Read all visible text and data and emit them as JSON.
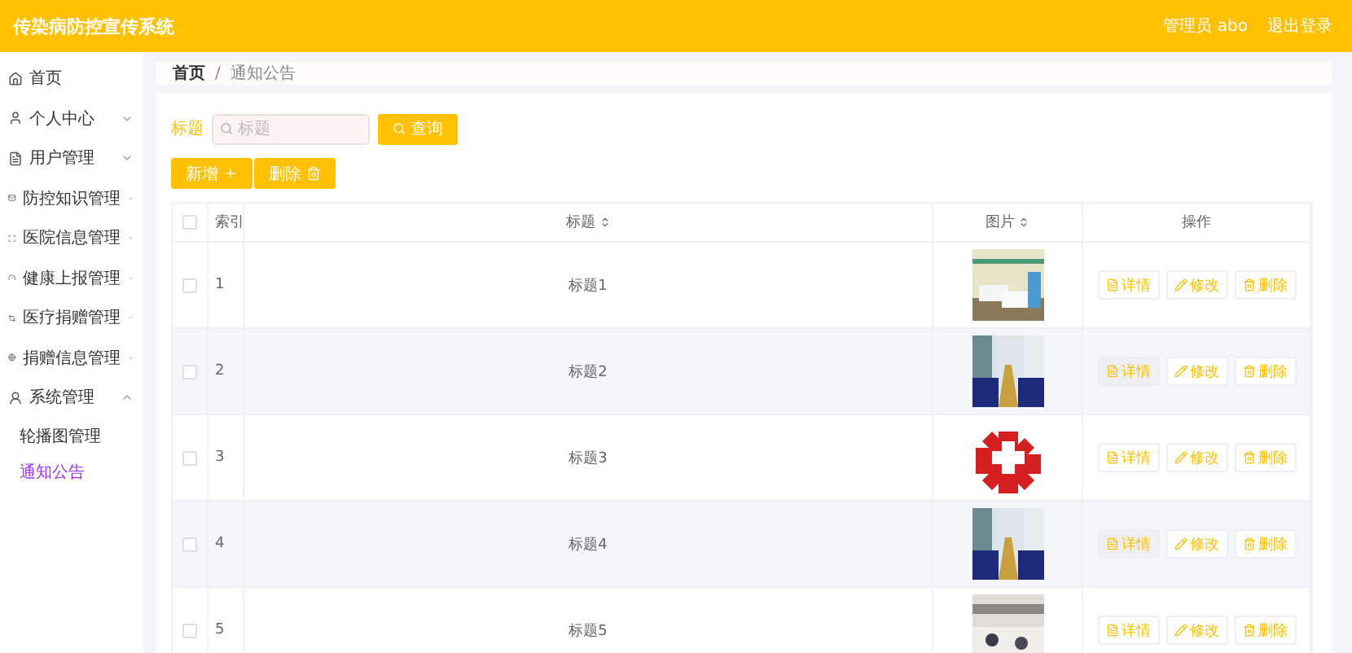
{
  "header": {
    "title": "传染病防控宣传系统",
    "user": "管理员 abo",
    "logout": "退出登录"
  },
  "sidebar": {
    "items": [
      {
        "label": "首页"
      },
      {
        "label": "个人中心",
        "expanded": false
      },
      {
        "label": "用户管理",
        "expanded": false
      },
      {
        "label": "防控知识管理",
        "expanded": false
      },
      {
        "label": "医院信息管理",
        "expanded": false
      },
      {
        "label": "健康上报管理",
        "expanded": false
      },
      {
        "label": "医疗捐赠管理",
        "expanded": false
      },
      {
        "label": "捐赠信息管理",
        "expanded": false
      },
      {
        "label": "系统管理",
        "expanded": true,
        "children": [
          {
            "label": "轮播图管理",
            "selected": false
          },
          {
            "label": "通知公告",
            "selected": true
          }
        ]
      }
    ]
  },
  "breadcrumb": {
    "items": [
      "首页",
      "通知公告"
    ],
    "separator": "/"
  },
  "search": {
    "label": "标题",
    "placeholder": "标题",
    "button": "查询"
  },
  "actions": [
    {
      "label": "新增",
      "kind": "add"
    },
    {
      "label": "删除",
      "kind": "delete"
    }
  ],
  "table": {
    "all_checked": false,
    "columns": [
      {
        "label": "索引",
        "sortable": false
      },
      {
        "label": "标题",
        "sortable": true
      },
      {
        "label": "图片",
        "sortable": true
      },
      {
        "label": "操作",
        "sortable": false
      }
    ],
    "rows": [
      {
        "index": "1",
        "title": "标题1",
        "checked": false,
        "picture": {
          "kind": "picture"
        },
        "actions": [
          {
            "label": "详情",
            "kind": "detail"
          },
          {
            "label": "修改",
            "kind": "edit"
          },
          {
            "label": "删除",
            "kind": "delete"
          }
        ]
      },
      {
        "index": "2",
        "title": "标题2",
        "checked": false,
        "picture": {
          "kind": "picture"
        },
        "actions": [
          {
            "label": "详情",
            "kind": "detail"
          },
          {
            "label": "修改",
            "kind": "edit"
          },
          {
            "label": "删除",
            "kind": "delete"
          }
        ]
      },
      {
        "index": "3",
        "title": "标题3",
        "checked": false,
        "picture": {
          "kind": "picture"
        },
        "actions": [
          {
            "label": "详情",
            "kind": "detail"
          },
          {
            "label": "修改",
            "kind": "edit"
          },
          {
            "label": "删除",
            "kind": "delete"
          }
        ]
      },
      {
        "index": "4",
        "title": "标题4",
        "checked": false,
        "picture": {
          "kind": "picture"
        },
        "actions": [
          {
            "label": "详情",
            "kind": "detail"
          },
          {
            "label": "修改",
            "kind": "edit"
          },
          {
            "label": "删除",
            "kind": "delete"
          }
        ]
      },
      {
        "index": "5",
        "title": "标题5",
        "checked": false,
        "picture": {
          "kind": "picture"
        },
        "actions": [
          {
            "label": "详情",
            "kind": "detail"
          },
          {
            "label": "修改",
            "kind": "edit"
          },
          {
            "label": "删除",
            "kind": "delete"
          }
        ]
      }
    ]
  }
}
